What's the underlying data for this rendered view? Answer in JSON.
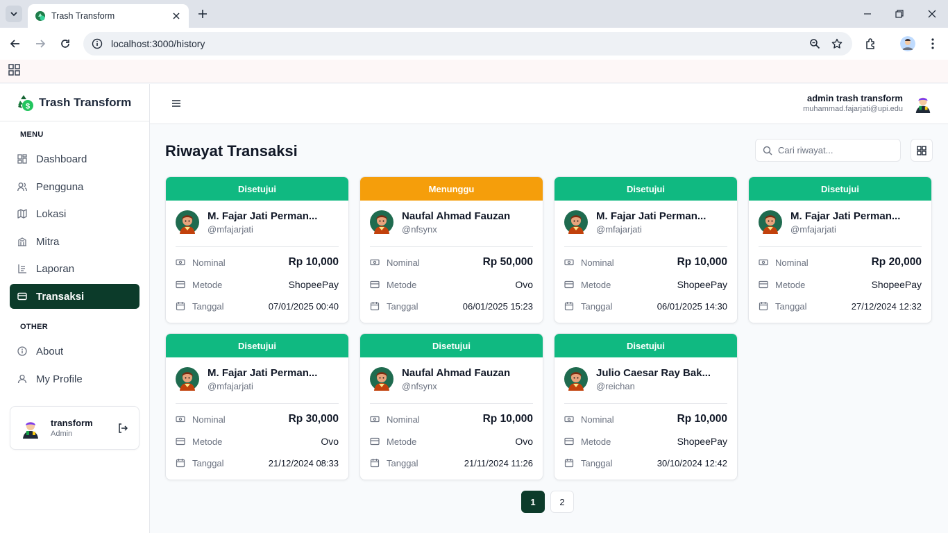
{
  "browser": {
    "tab_title": "Trash Transform",
    "url": "localhost:3000/history"
  },
  "sidebar": {
    "brand": "Trash Transform",
    "menu_label": "MENU",
    "other_label": "OTHER",
    "menu_items": [
      {
        "label": "Dashboard",
        "icon": "dashboard-icon"
      },
      {
        "label": "Pengguna",
        "icon": "users-icon"
      },
      {
        "label": "Lokasi",
        "icon": "map-icon"
      },
      {
        "label": "Mitra",
        "icon": "building-icon"
      },
      {
        "label": "Laporan",
        "icon": "report-icon"
      },
      {
        "label": "Transaksi",
        "icon": "card-icon",
        "active": true
      }
    ],
    "other_items": [
      {
        "label": "About",
        "icon": "info-icon"
      },
      {
        "label": "My Profile",
        "icon": "user-icon"
      }
    ],
    "user": {
      "name": "transform",
      "role": "Admin"
    }
  },
  "topbar": {
    "user_name": "admin trash transform",
    "user_email": "muhammad.fajarjati@upi.edu"
  },
  "main": {
    "title": "Riwayat Transaksi",
    "search_placeholder": "Cari riwayat...",
    "labels": {
      "nominal": "Nominal",
      "metode": "Metode",
      "tanggal": "Tanggal"
    },
    "transactions": [
      {
        "status": "Disetujui",
        "status_type": "approved",
        "name": "M. Fajar Jati Perman...",
        "handle": "@mfajarjati",
        "nominal": "Rp 10,000",
        "metode": "ShopeePay",
        "tanggal": "07/01/2025 00:40"
      },
      {
        "status": "Menunggu",
        "status_type": "pending",
        "name": "Naufal Ahmad Fauzan",
        "handle": "@nfsynx",
        "nominal": "Rp 50,000",
        "metode": "Ovo",
        "tanggal": "06/01/2025 15:23"
      },
      {
        "status": "Disetujui",
        "status_type": "approved",
        "name": "M. Fajar Jati Perman...",
        "handle": "@mfajarjati",
        "nominal": "Rp 10,000",
        "metode": "ShopeePay",
        "tanggal": "06/01/2025 14:30"
      },
      {
        "status": "Disetujui",
        "status_type": "approved",
        "name": "M. Fajar Jati Perman...",
        "handle": "@mfajarjati",
        "nominal": "Rp 20,000",
        "metode": "ShopeePay",
        "tanggal": "27/12/2024 12:32"
      },
      {
        "status": "Disetujui",
        "status_type": "approved",
        "name": "M. Fajar Jati Perman...",
        "handle": "@mfajarjati",
        "nominal": "Rp 30,000",
        "metode": "Ovo",
        "tanggal": "21/12/2024 08:33"
      },
      {
        "status": "Disetujui",
        "status_type": "approved",
        "name": "Naufal Ahmad Fauzan",
        "handle": "@nfsynx",
        "nominal": "Rp 10,000",
        "metode": "Ovo",
        "tanggal": "21/11/2024 11:26"
      },
      {
        "status": "Disetujui",
        "status_type": "approved",
        "name": "Julio Caesar Ray Bak...",
        "handle": "@reichan",
        "nominal": "Rp 10,000",
        "metode": "ShopeePay",
        "tanggal": "30/10/2024 12:42"
      }
    ],
    "pagination": {
      "pages": [
        "1",
        "2"
      ],
      "current": "1"
    }
  },
  "colors": {
    "approved": "#10b981",
    "pending": "#f59e0b",
    "active_nav": "#0c3b2a"
  }
}
